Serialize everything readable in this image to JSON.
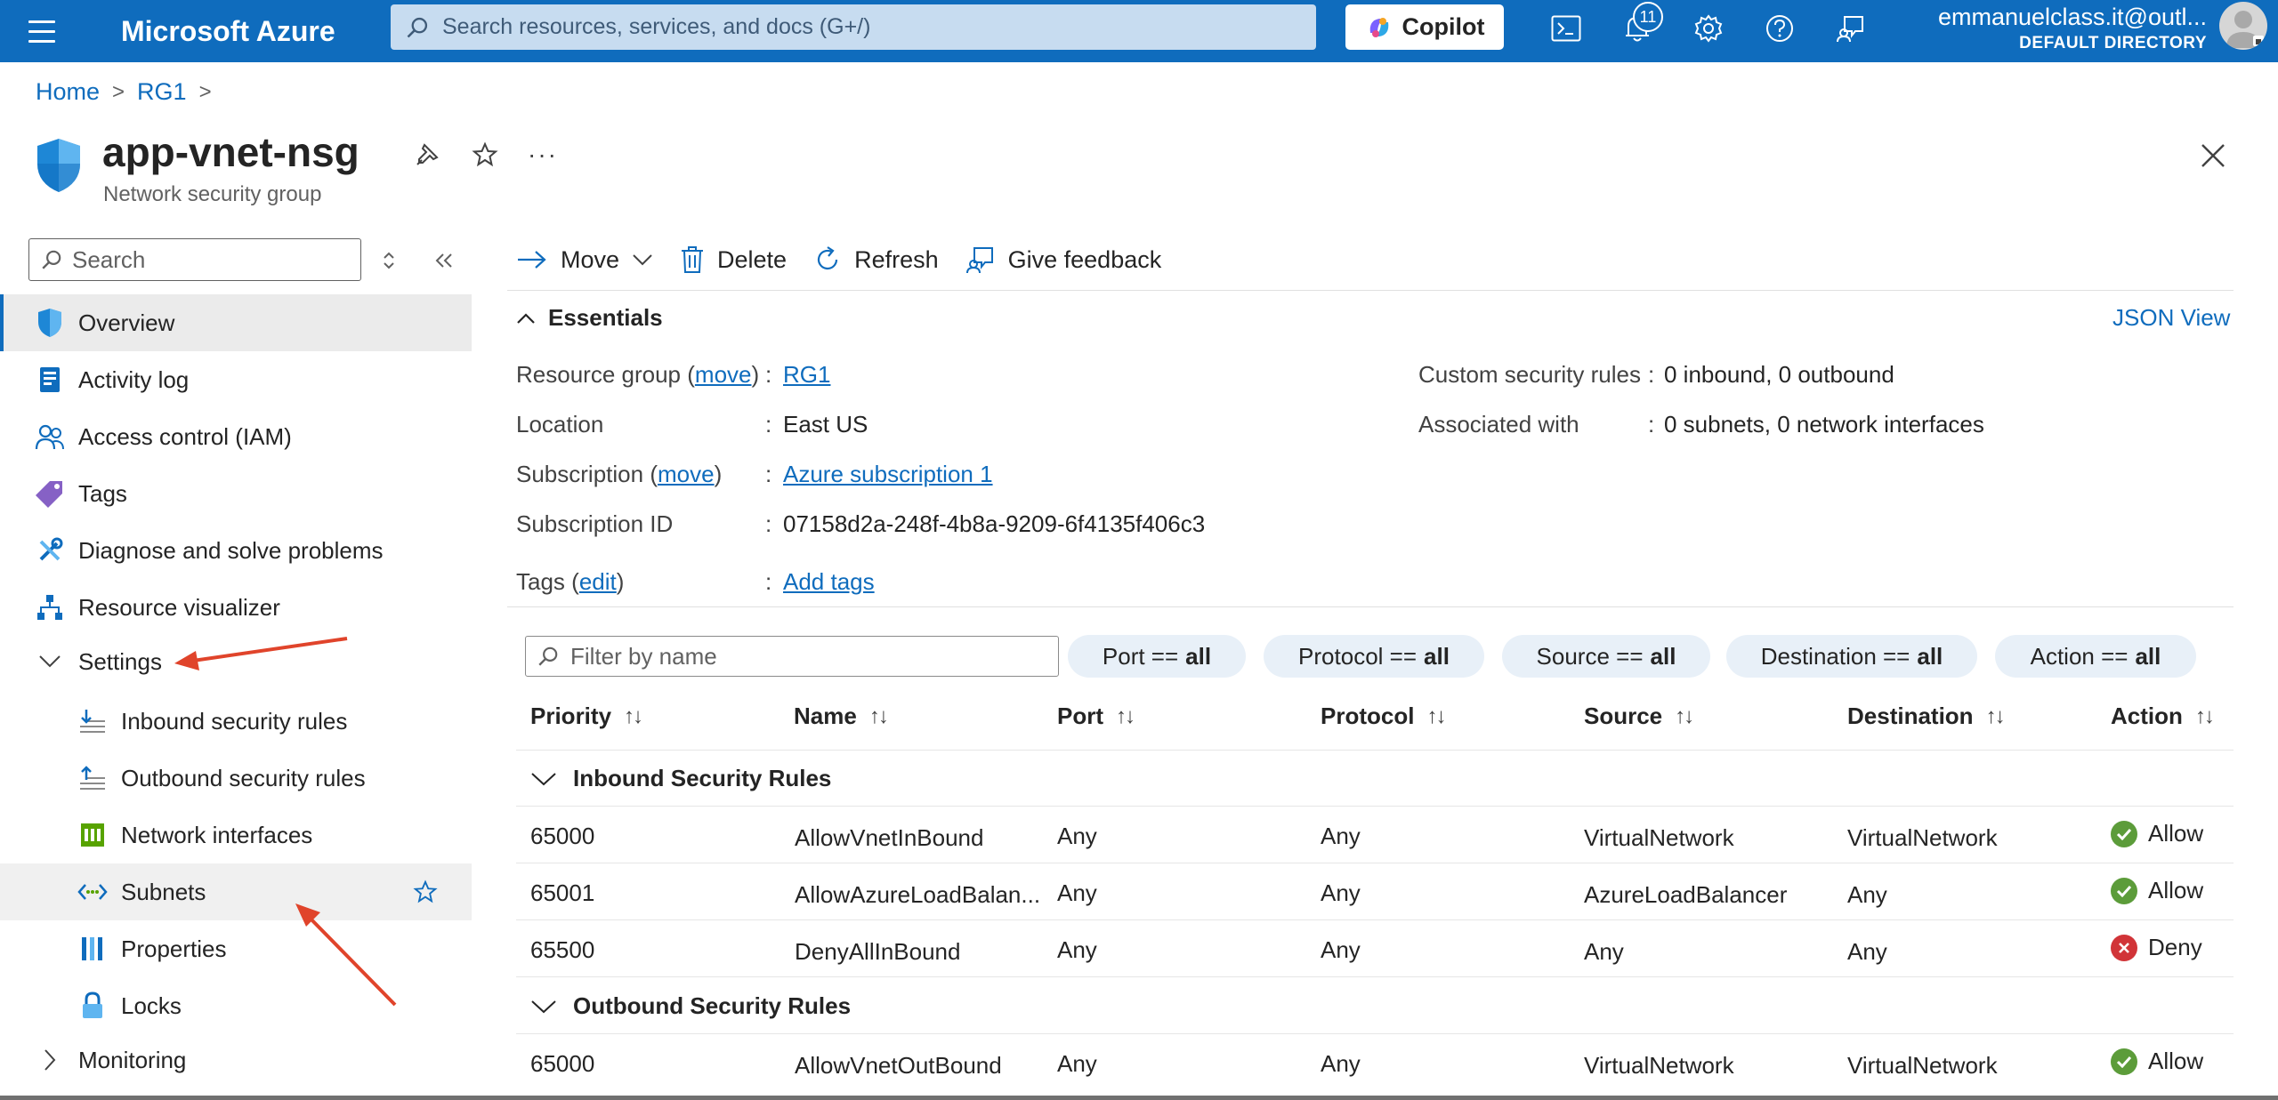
{
  "topbar": {
    "brand": "Microsoft Azure",
    "search_placeholder": "Search resources, services, and docs (G+/)",
    "copilot_label": "Copilot",
    "notification_count": "11",
    "account_email": "emmanuelclass.it@outl...",
    "account_directory": "DEFAULT DIRECTORY"
  },
  "breadcrumb": {
    "home": "Home",
    "rg": "RG1"
  },
  "resource": {
    "name": "app-vnet-nsg",
    "type": "Network security group"
  },
  "sidebar": {
    "search_placeholder": "Search",
    "items": [
      {
        "label": "Overview",
        "icon": "shield-icon"
      },
      {
        "label": "Activity log",
        "icon": "activity-log-icon"
      },
      {
        "label": "Access control (IAM)",
        "icon": "people-icon"
      },
      {
        "label": "Tags",
        "icon": "tag-icon"
      },
      {
        "label": "Diagnose and solve problems",
        "icon": "wrench-icon"
      },
      {
        "label": "Resource visualizer",
        "icon": "hierarchy-icon"
      },
      {
        "label": "Settings",
        "icon": "chevron-down-icon"
      },
      {
        "label": "Inbound security rules",
        "icon": "inbound-rules-icon"
      },
      {
        "label": "Outbound security rules",
        "icon": "outbound-rules-icon"
      },
      {
        "label": "Network interfaces",
        "icon": "nic-icon"
      },
      {
        "label": "Subnets",
        "icon": "subnet-icon"
      },
      {
        "label": "Properties",
        "icon": "properties-icon"
      },
      {
        "label": "Locks",
        "icon": "lock-icon"
      },
      {
        "label": "Monitoring",
        "icon": "chevron-right-icon"
      }
    ]
  },
  "toolbar": {
    "move": "Move",
    "delete": "Delete",
    "refresh": "Refresh",
    "feedback": "Give feedback"
  },
  "essentials": {
    "title": "Essentials",
    "json_view": "JSON View",
    "resource_group_label": "Resource group",
    "move_link": "move",
    "resource_group_value": "RG1",
    "location_label": "Location",
    "location_value": "East US",
    "subscription_label": "Subscription",
    "subscription_value": "Azure subscription 1",
    "subscription_id_label": "Subscription ID",
    "subscription_id_value": "07158d2a-248f-4b8a-9209-6f4135f406c3",
    "tags_label": "Tags",
    "edit_link": "edit",
    "tags_value": "Add tags",
    "custom_rules_label": "Custom security rules",
    "custom_rules_value": "0 inbound, 0 outbound",
    "associated_label": "Associated with",
    "associated_value": "0 subnets, 0 network interfaces",
    "colon": ":",
    "open_paren": "(",
    "close_paren": ")"
  },
  "filters": {
    "name_placeholder": "Filter by name",
    "pills": [
      {
        "field": "Port ==",
        "value": "all"
      },
      {
        "field": "Protocol ==",
        "value": "all"
      },
      {
        "field": "Source ==",
        "value": "all"
      },
      {
        "field": "Destination ==",
        "value": "all"
      },
      {
        "field": "Action ==",
        "value": "all"
      }
    ]
  },
  "table": {
    "columns": [
      "Priority",
      "Name",
      "Port",
      "Protocol",
      "Source",
      "Destination",
      "Action"
    ],
    "groups": [
      {
        "title": "Inbound Security Rules",
        "rows": [
          {
            "priority": "65000",
            "name": "AllowVnetInBound",
            "port": "Any",
            "protocol": "Any",
            "source": "VirtualNetwork",
            "destination": "VirtualNetwork",
            "action": "Allow"
          },
          {
            "priority": "65001",
            "name": "AllowAzureLoadBalan...",
            "port": "Any",
            "protocol": "Any",
            "source": "AzureLoadBalancer",
            "destination": "Any",
            "action": "Allow"
          },
          {
            "priority": "65500",
            "name": "DenyAllInBound",
            "port": "Any",
            "protocol": "Any",
            "source": "Any",
            "destination": "Any",
            "action": "Deny"
          }
        ]
      },
      {
        "title": "Outbound Security Rules",
        "rows": [
          {
            "priority": "65000",
            "name": "AllowVnetOutBound",
            "port": "Any",
            "protocol": "Any",
            "source": "VirtualNetwork",
            "destination": "VirtualNetwork",
            "action": "Allow"
          }
        ]
      }
    ]
  },
  "colors": {
    "accent": "#0f6cbd",
    "allow": "#5c9c3a",
    "deny": "#d13438",
    "annotation_arrow": "#e0442b"
  }
}
